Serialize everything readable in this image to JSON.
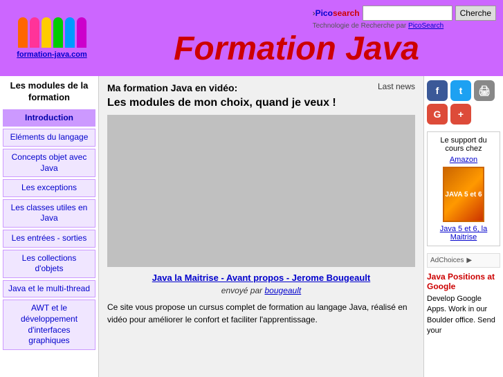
{
  "header": {
    "logo_text": "formation-java.com",
    "title": "Formation Java",
    "search": {
      "pico_label": "Picosearch",
      "input_placeholder": "",
      "button_label": "Cherche",
      "sub_text": "Technologie de Recherche par",
      "sub_link": "PicoSearch"
    }
  },
  "sidebar": {
    "title": "Les modules de la formation",
    "items": [
      {
        "label": "Introduction",
        "active": true
      },
      {
        "label": "Eléments du langage",
        "active": false
      },
      {
        "label": "Concepts objet avec Java",
        "active": false
      },
      {
        "label": "Les exceptions",
        "active": false
      },
      {
        "label": "Les classes utiles en Java",
        "active": false
      },
      {
        "label": "Les entrées - sorties",
        "active": false
      },
      {
        "label": "Les collections d'objets",
        "active": false
      },
      {
        "label": "Java et le multi-thread",
        "active": false
      },
      {
        "label": "AWT et le développement d'interfaces graphiques",
        "active": false
      }
    ]
  },
  "content": {
    "title": "Ma formation Java en vidéo:",
    "subtitle": "Les modules de mon choix, quand je veux !",
    "last_news": "Last news",
    "video_link": "Java la Maitrise - Avant propos - Jerome Bougeault",
    "sent_by_label": "envoyé par",
    "sent_by_link": "bougeault",
    "description": "Ce site vous propose un cursus complet de formation au langage Java, réalisé en vidéo pour améliorer le confort et faciliter l'apprentissage."
  },
  "right_panel": {
    "social": [
      {
        "name": "facebook",
        "label": "f"
      },
      {
        "name": "twitter",
        "label": "t"
      },
      {
        "name": "print",
        "label": "🖨"
      },
      {
        "name": "google",
        "label": "G"
      },
      {
        "name": "gplus",
        "label": "+"
      }
    ],
    "book": {
      "intro": "Le support du cours chez",
      "store_link": "Amazon",
      "cover_text": "JAVA 5 et 6",
      "desc_link": "Java 5 et 6, la Maitrise"
    },
    "ad_choices_label": "AdChoices",
    "ad": {
      "title": "Java Positions at Google",
      "content": "Develop Google Apps. Work in our Boulder office. Send your"
    }
  }
}
